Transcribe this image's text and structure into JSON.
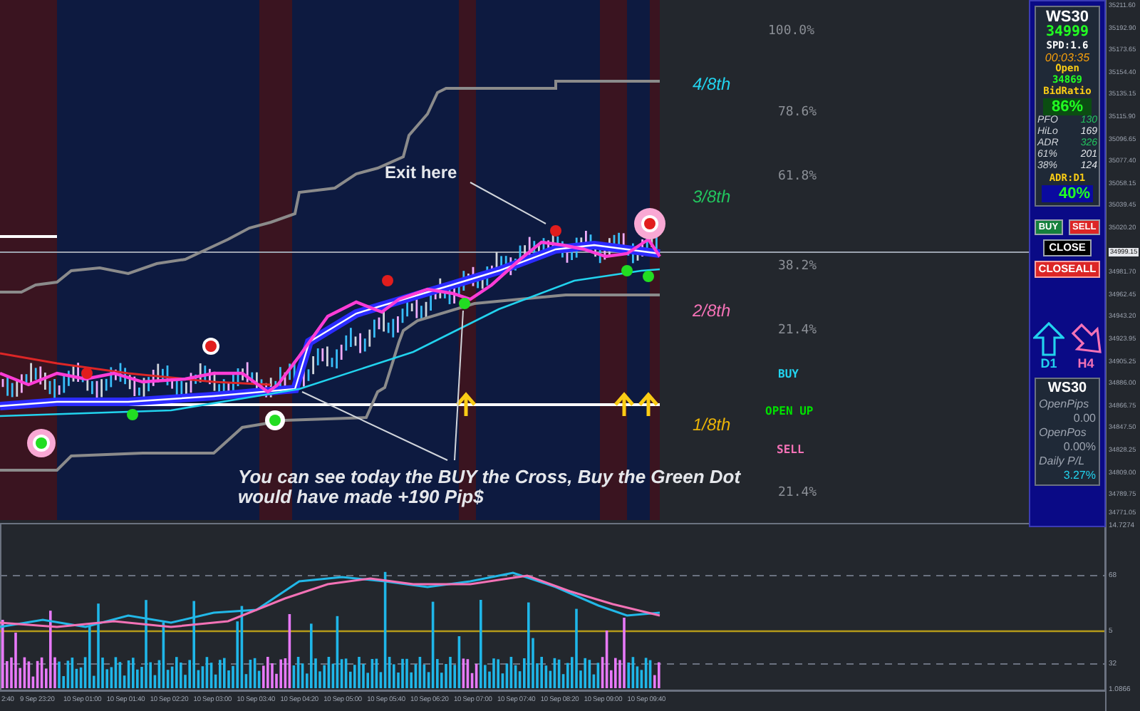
{
  "chart": {
    "exit_label": "Exit here",
    "note": "You can see today the BUY the Cross, Buy the Green Dot would have made +190 Pip$",
    "fib_levels": [
      {
        "label": "100.0%"
      },
      {
        "label": "78.6%"
      },
      {
        "label": "61.8%"
      },
      {
        "label": "38.2%"
      },
      {
        "label": "21.4%"
      },
      {
        "label": "21.4%"
      }
    ],
    "eighths": [
      {
        "label": "4/8th",
        "color": "#22d3ee"
      },
      {
        "label": "3/8th",
        "color": "#22c55e"
      },
      {
        "label": "2/8th",
        "color": "#f472b6"
      },
      {
        "label": "1/8th",
        "color": "#eab308"
      }
    ],
    "signals": [
      {
        "label": "BUY",
        "color": "#22d3ee"
      },
      {
        "label": "OPEN UP",
        "color": "#00e000"
      },
      {
        "label": "SELL",
        "color": "#f472b6"
      }
    ]
  },
  "price_axis": [
    "35211.60",
    "35192.90",
    "35173.65",
    "35154.40",
    "35135.15",
    "35115.90",
    "35096.65",
    "35077.40",
    "35058.15",
    "35039.45",
    "35020.20",
    "34981.70",
    "34962.45",
    "34943.20",
    "34923.95",
    "34905.25",
    "34886.00",
    "34866.75",
    "34847.50",
    "34828.25",
    "34809.00",
    "34789.75",
    "34771.05"
  ],
  "current_price": "34999.15",
  "indicator_axis": [
    "14.7274",
    "68",
    "5",
    "32",
    "1.0866"
  ],
  "time_axis": [
    "2:40",
    "9 Sep 23:20",
    "10 Sep 01:00",
    "10 Sep 01:40",
    "10 Sep 02:20",
    "10 Sep 03:00",
    "10 Sep 03:40",
    "10 Sep 04:20",
    "10 Sep 05:00",
    "10 Sep 05:40",
    "10 Sep 06:20",
    "10 Sep 07:00",
    "10 Sep 07:40",
    "10 Sep 08:20",
    "10 Sep 09:00",
    "10 Sep 09:40"
  ],
  "panel": {
    "symbol": "WS30",
    "price": "34999",
    "spread": "SPD:1.6",
    "timer": "00:03:35",
    "open_label": "Open",
    "open_price": "34869",
    "bid_ratio_label": "BidRatio",
    "bid_ratio": "86%",
    "stats": [
      {
        "label": "PFO",
        "value": "130",
        "color": "#22c55e"
      },
      {
        "label": "HiLo",
        "value": "169",
        "color": "#e5e7eb"
      },
      {
        "label": "ADR",
        "value": "326",
        "color": "#22c55e"
      },
      {
        "label": "61%",
        "value": "201",
        "color": "#e5e7eb"
      },
      {
        "label": "38%",
        "value": "124",
        "color": "#e5e7eb"
      }
    ],
    "adr_label": "ADR:D1",
    "adr_value": "40%",
    "buttons": [
      {
        "label": "BUY",
        "kind": "buy"
      },
      {
        "label": "SELL",
        "kind": "sell"
      },
      {
        "label": "CLOSE",
        "kind": "close"
      },
      {
        "label": "CLOSEALL",
        "kind": "closeall"
      }
    ],
    "arrows": [
      {
        "label": "D1",
        "kind": "up"
      },
      {
        "label": "H4",
        "kind": "down_right"
      }
    ],
    "account": {
      "symbol": "WS30",
      "rows": [
        {
          "label": "OpenPips",
          "value": "0.00"
        },
        {
          "label": "OpenPos",
          "value": "0.00%"
        },
        {
          "label": "Daily P/L",
          "value": "3.27%",
          "kind": "highlight"
        }
      ]
    }
  }
}
